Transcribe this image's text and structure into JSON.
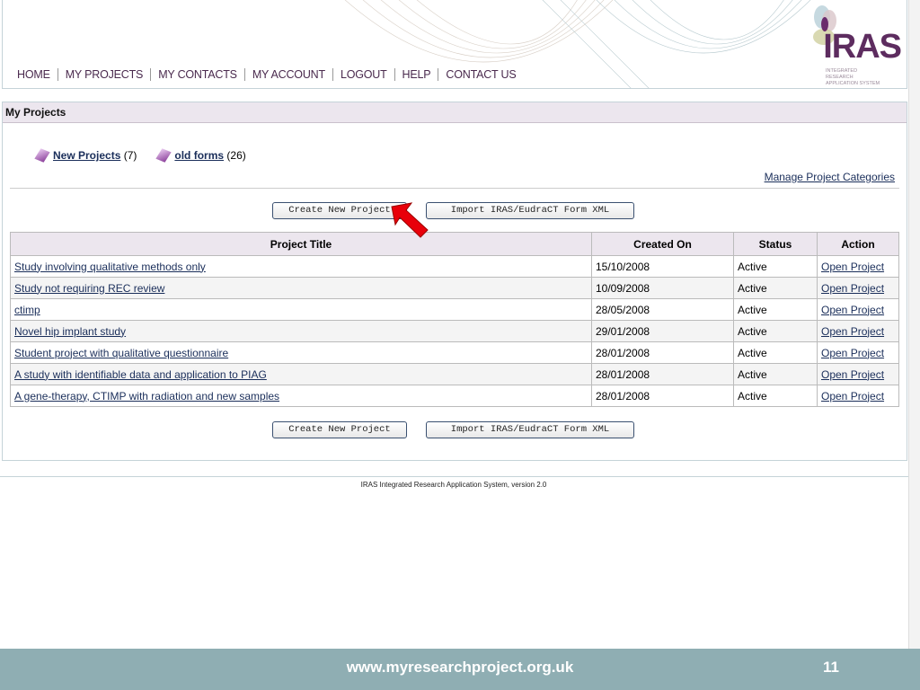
{
  "nav": [
    "HOME",
    "MY PROJECTS",
    "MY CONTACTS",
    "MY ACCOUNT",
    "LOGOUT",
    "HELP",
    "CONTACT US"
  ],
  "logo": {
    "name": "IRAS",
    "subtitle": "INTEGRATED RESEARCH APPLICATION SYSTEM"
  },
  "panel": {
    "title": "My Projects",
    "categories": [
      {
        "label": "New Projects",
        "count": "(7)"
      },
      {
        "label": "old forms",
        "count": "(26)"
      }
    ],
    "manage": "Manage Project Categories",
    "create_btn": "Create New Project",
    "import_btn": "Import IRAS/EudraCT Form XML"
  },
  "table": {
    "headers": [
      "Project Title",
      "Created On",
      "Status",
      "Action"
    ],
    "rows": [
      [
        "Study involving qualitative methods only",
        "15/10/2008",
        "Active",
        "Open Project"
      ],
      [
        "Study not requiring REC review",
        "10/09/2008",
        "Active",
        "Open Project"
      ],
      [
        "ctimp",
        "28/05/2008",
        "Active",
        "Open Project"
      ],
      [
        "Novel hip implant study",
        "29/01/2008",
        "Active",
        "Open Project"
      ],
      [
        "Student project with qualitative questionnaire",
        "28/01/2008",
        "Active",
        "Open Project"
      ],
      [
        "A study with identifiable data and application to PIAG",
        "28/01/2008",
        "Active",
        "Open Project"
      ],
      [
        "A gene-therapy, CTIMP with radiation and new samples",
        "28/01/2008",
        "Active",
        "Open Project"
      ]
    ]
  },
  "footer": "IRAS Integrated Research Application System, version 2.0",
  "slide": {
    "url": "www.myresearchproject.org.uk",
    "page": "11"
  }
}
